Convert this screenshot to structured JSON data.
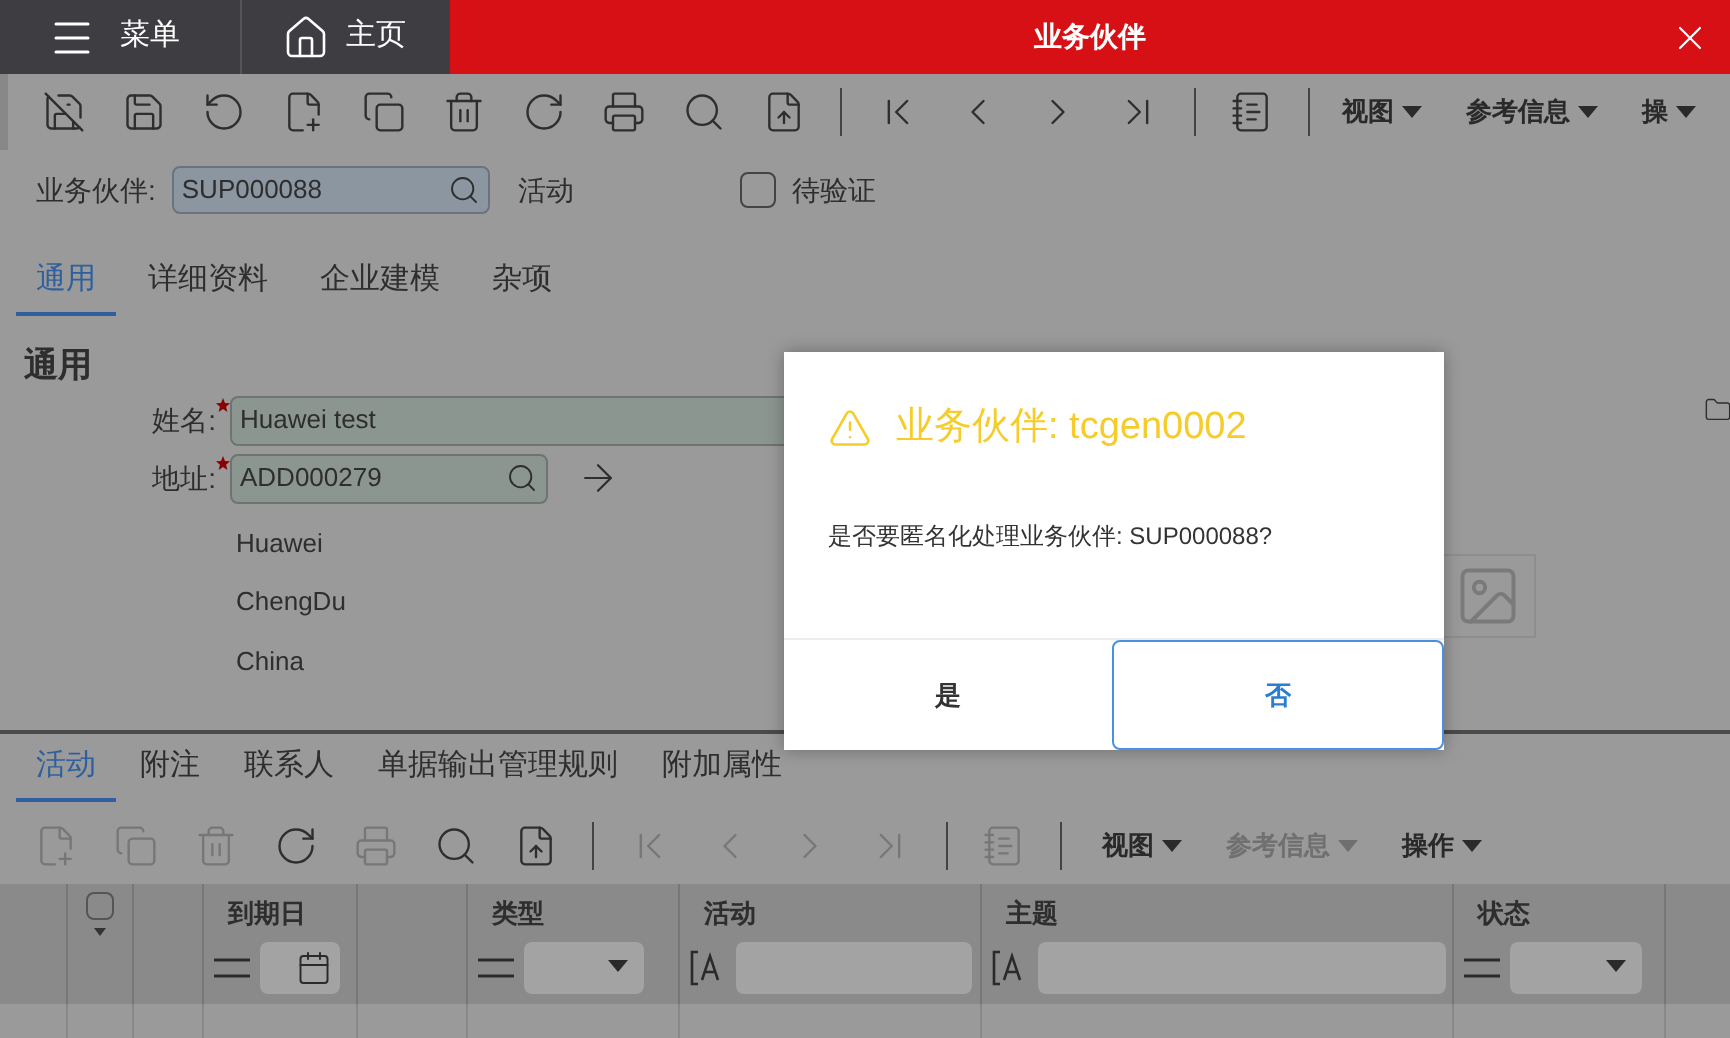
{
  "header": {
    "menu_label": "菜单",
    "home_label": "主页",
    "title": "业务伙伴"
  },
  "toolbar": {
    "menus": [
      {
        "label": "视图",
        "disabled": false
      },
      {
        "label": "参考信息",
        "disabled": false
      },
      {
        "label": "操",
        "disabled": false
      }
    ]
  },
  "record": {
    "label": "业务伙伴:",
    "value": "SUP000088",
    "status": "活动",
    "pending": {
      "label": "待验证",
      "checked": false
    }
  },
  "tabs": [
    {
      "label": "通用",
      "selected": true
    },
    {
      "label": "详细资料",
      "selected": false
    },
    {
      "label": "企业建模",
      "selected": false
    },
    {
      "label": "杂项",
      "selected": false
    }
  ],
  "general": {
    "heading": "通用",
    "fields": [
      {
        "label": "姓名:",
        "required": true,
        "value": "Huawei test",
        "kind": "text"
      },
      {
        "label": "地址:",
        "required": true,
        "value": "ADD000279",
        "kind": "lookup"
      }
    ],
    "address_lines": [
      "Huawei",
      "ChengDu",
      "China"
    ]
  },
  "dialog": {
    "title": "业务伙伴: tcgen0002",
    "message": "是否要匿名化处理业务伙伴: SUP000088?",
    "buttons": [
      {
        "label": "是",
        "selected": false
      },
      {
        "label": "否",
        "selected": true
      }
    ]
  },
  "sub_tabs": [
    {
      "label": "活动",
      "selected": true
    },
    {
      "label": "附注",
      "selected": false
    },
    {
      "label": "联系人",
      "selected": false
    },
    {
      "label": "单据输出管理规则",
      "selected": false
    },
    {
      "label": "附加属性",
      "selected": false
    }
  ],
  "sub_toolbar": {
    "icon_buttons": [
      {
        "disabled": true
      },
      {
        "disabled": true
      },
      {
        "disabled": true
      },
      {
        "disabled": false
      },
      {
        "disabled": true
      },
      {
        "disabled": false
      },
      {
        "disabled": false
      },
      {
        "disabled": true
      },
      {
        "disabled": true
      },
      {
        "disabled": true
      },
      {
        "disabled": true
      },
      {
        "disabled": true
      }
    ],
    "menus": [
      {
        "label": "视图",
        "disabled": false
      },
      {
        "label": "参考信息",
        "disabled": true
      },
      {
        "label": "操作",
        "disabled": false
      }
    ]
  },
  "table": {
    "select_all": {
      "checked": false
    },
    "columns": [
      {
        "label": "到期日",
        "kind": "date"
      },
      {
        "label": "类型",
        "kind": "select"
      },
      {
        "label": "活动",
        "kind": "text"
      },
      {
        "label": "主题",
        "kind": "text"
      },
      {
        "label": "状态",
        "kind": "select"
      }
    ]
  }
}
